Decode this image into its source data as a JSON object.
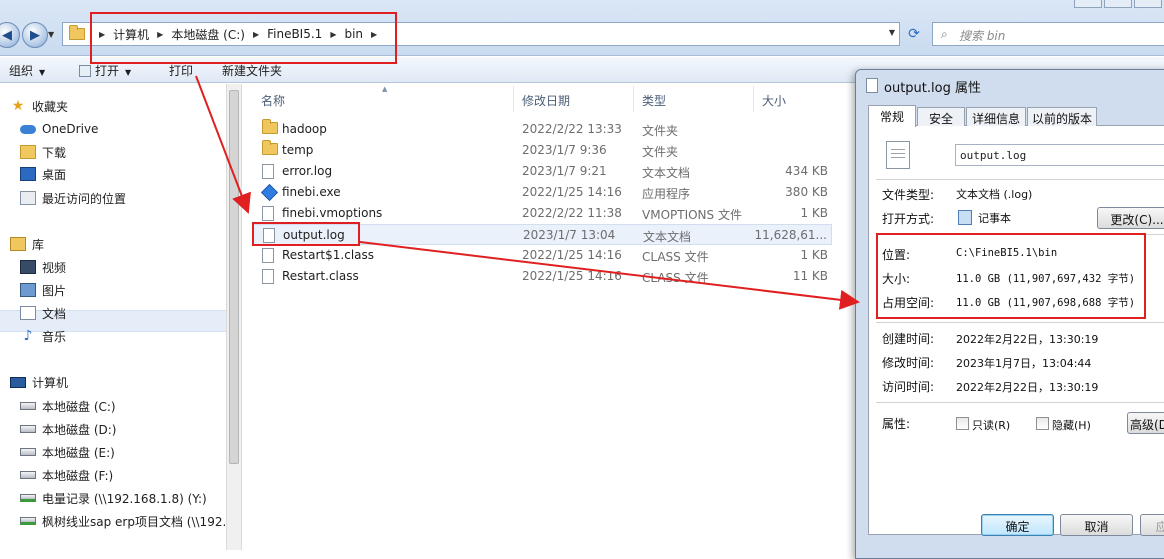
{
  "address_bar": {
    "crumbs": [
      "计算机",
      "本地磁盘 (C:)",
      "FineBI5.1",
      "bin"
    ],
    "search_placeholder": "搜索 bin"
  },
  "toolbar": {
    "organize": "组织",
    "open": "打开",
    "print": "打印",
    "new_folder": "新建文件夹"
  },
  "nav": {
    "favorites": "收藏夹",
    "fav_items": [
      "OneDrive",
      "下载",
      "桌面",
      "最近访问的位置"
    ],
    "libraries": "库",
    "lib_items": [
      "视频",
      "图片",
      "文档",
      "音乐"
    ],
    "computer": "计算机",
    "drives": [
      "本地磁盘 (C:)",
      "本地磁盘 (D:)",
      "本地磁盘 (E:)",
      "本地磁盘 (F:)",
      "电量记录 (\\\\192.168.1.8) (Y:)",
      "枫树线业sap erp项目文档 (\\\\192."
    ]
  },
  "columns": {
    "name": "名称",
    "date": "修改日期",
    "type": "类型",
    "size": "大小"
  },
  "files": [
    {
      "name": "hadoop",
      "date": "2022/2/22 13:33",
      "type": "文件夹",
      "size": "",
      "icon": "folder-icon"
    },
    {
      "name": "temp",
      "date": "2023/1/7 9:36",
      "type": "文件夹",
      "size": "",
      "icon": "folder-icon"
    },
    {
      "name": "error.log",
      "date": "2023/1/7 9:21",
      "type": "文本文档",
      "size": "434 KB",
      "icon": "text-file-icon"
    },
    {
      "name": "finebi.exe",
      "date": "2022/1/25 14:16",
      "type": "应用程序",
      "size": "380 KB",
      "icon": "app-icon"
    },
    {
      "name": "finebi.vmoptions",
      "date": "2022/2/22 11:38",
      "type": "VMOPTIONS 文件",
      "size": "1 KB",
      "icon": "file-icon"
    },
    {
      "name": "output.log",
      "date": "2023/1/7 13:04",
      "type": "文本文档",
      "size": "11,628,61...",
      "icon": "text-file-icon"
    },
    {
      "name": "Restart$1.class",
      "date": "2022/1/25 14:16",
      "type": "CLASS 文件",
      "size": "1 KB",
      "icon": "file-icon"
    },
    {
      "name": "Restart.class",
      "date": "2022/1/25 14:16",
      "type": "CLASS 文件",
      "size": "11 KB",
      "icon": "file-icon"
    }
  ],
  "dialog": {
    "title": "output.log 属性",
    "tabs": [
      "常规",
      "安全",
      "详细信息",
      "以前的版本"
    ],
    "filename": "output.log",
    "file_type_label": "文件类型:",
    "file_type_value": "文本文档 (.log)",
    "open_with_label": "打开方式:",
    "open_with_value": "记事本",
    "change_button": "更改(C)...",
    "location_label": "位置:",
    "location_value": "C:\\FineBI5.1\\bin",
    "size_label": "大小:",
    "size_value": "11.0 GB (11,907,697,432 字节)",
    "disk_size_label": "占用空间:",
    "disk_size_value": "11.0 GB (11,907,698,688 字节)",
    "created_label": "创建时间:",
    "created_value": "2022年2月22日，13:30:19",
    "modified_label": "修改时间:",
    "modified_value": "2023年1月7日，13:04:44",
    "accessed_label": "访问时间:",
    "accessed_value": "2022年2月22日，13:30:19",
    "attributes_label": "属性:",
    "readonly_label": "只读(R)",
    "hidden_label": "隐藏(H)",
    "advanced_button": "高级(D)...",
    "ok_button": "确定",
    "cancel_button": "取消",
    "apply_button": "应用(A)"
  },
  "colors": {
    "highlight": "#e02020",
    "selection": "#eaf1fb"
  }
}
